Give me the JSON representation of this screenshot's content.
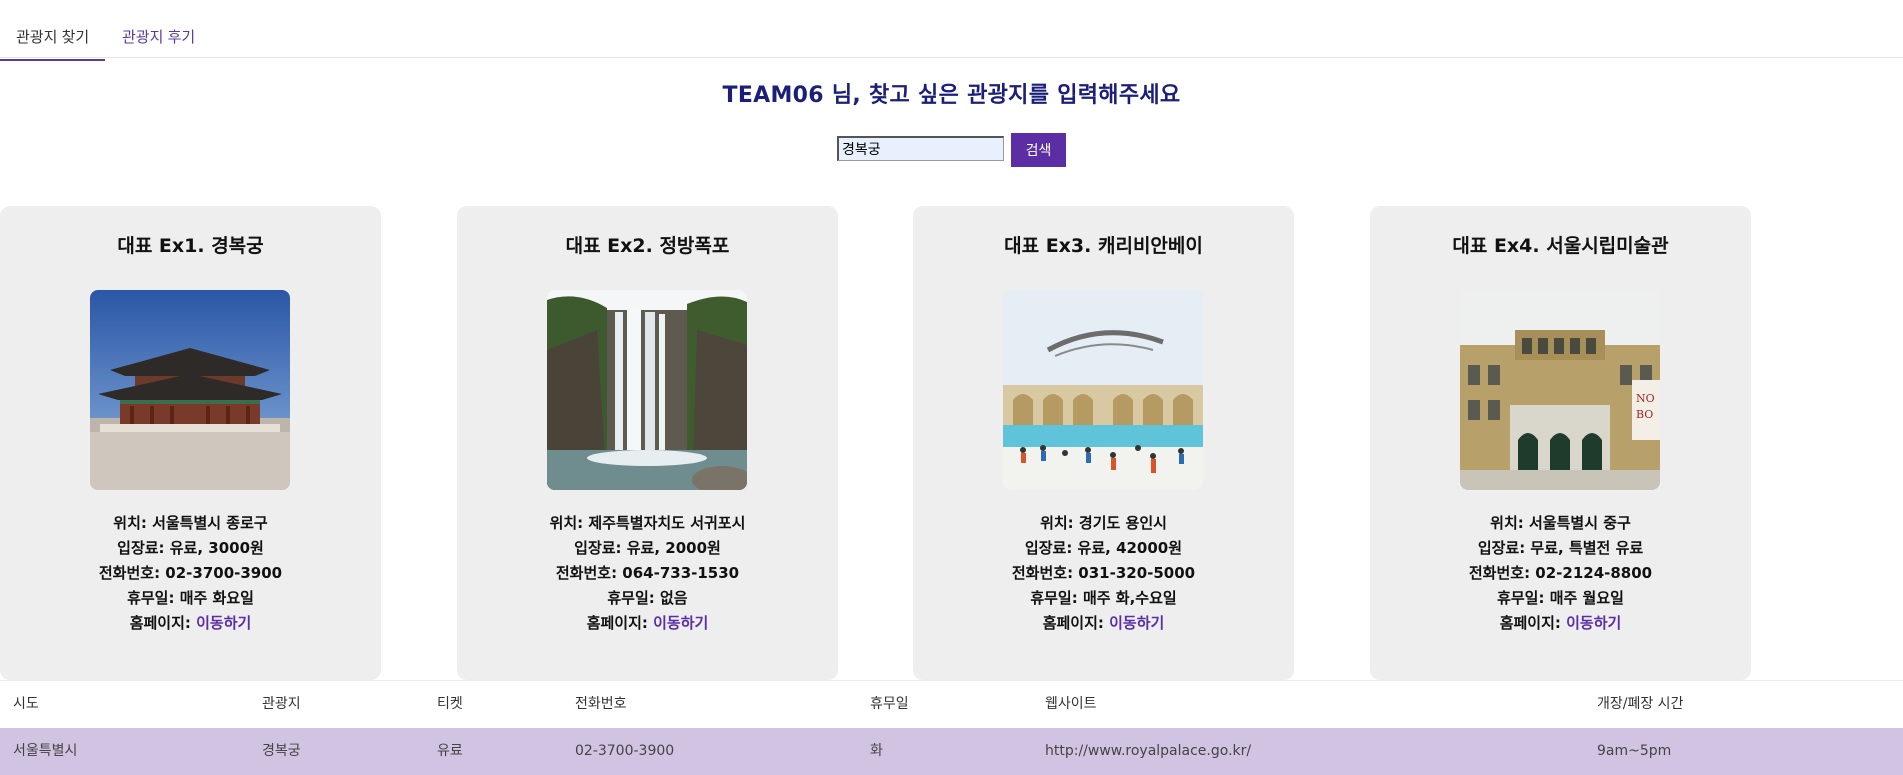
{
  "tabs": [
    {
      "label": "관광지 찾기",
      "active": true
    },
    {
      "label": "관광지 후기",
      "active": false
    }
  ],
  "headline": "TEAM06 님, 찾고 싶은 관광지를 입력해주세요",
  "search": {
    "value": "경복궁",
    "button_label": "검색"
  },
  "colors": {
    "accent": "#5b2ea6",
    "headline": "#1c1f7a",
    "card_bg": "#eeeeee",
    "row_highlight": "#d1c4e2"
  },
  "cards": [
    {
      "title": "대표 Ex1. 경복궁",
      "image": "gyeongbokgung-palace-photo",
      "location": "위치: 서울특별시 종로구",
      "fee": "입장료: 유료, 3000원",
      "phone": "전화번호: 02-3700-3900",
      "closed": "휴무일: 매주 화요일",
      "homepage_label": "홈페이지: ",
      "homepage_link": "이동하기"
    },
    {
      "title": "대표 Ex2. 정방폭포",
      "image": "jeongbang-waterfall-photo",
      "location": "위치: 제주특별자치도 서귀포시",
      "fee": "입장료: 유료, 2000원",
      "phone": "전화번호: 064-733-1530",
      "closed": "휴무일: 없음",
      "homepage_label": "홈페이지: ",
      "homepage_link": "이동하기"
    },
    {
      "title": "대표 Ex3. 캐리비안베이",
      "image": "caribbean-bay-photo",
      "location": "위치: 경기도 용인시",
      "fee": "입장료: 유료, 42000원",
      "phone": "전화번호: 031-320-5000",
      "closed": "휴무일: 매주 화,수요일",
      "homepage_label": "홈페이지: ",
      "homepage_link": "이동하기"
    },
    {
      "title": "대표 Ex4. 서울시립미술관",
      "image": "seoul-museum-of-art-photo",
      "location": "위치: 서울특별시 중구",
      "fee": "입장료: 무료, 특별전 유료",
      "phone": "전화번호: 02-2124-8800",
      "closed": "휴무일: 매주 월요일",
      "homepage_label": "홈페이지: ",
      "homepage_link": "이동하기"
    }
  ],
  "table": {
    "headers": [
      "시도",
      "관광지",
      "티켓",
      "전화번호",
      "휴무일",
      "웹사이트",
      "개장/폐장 시간"
    ],
    "rows": [
      [
        "서울특별시",
        "경복궁",
        "유료",
        "02-3700-3900",
        "화",
        "http://www.royalpalace.go.kr/",
        "9am~5pm"
      ]
    ]
  }
}
